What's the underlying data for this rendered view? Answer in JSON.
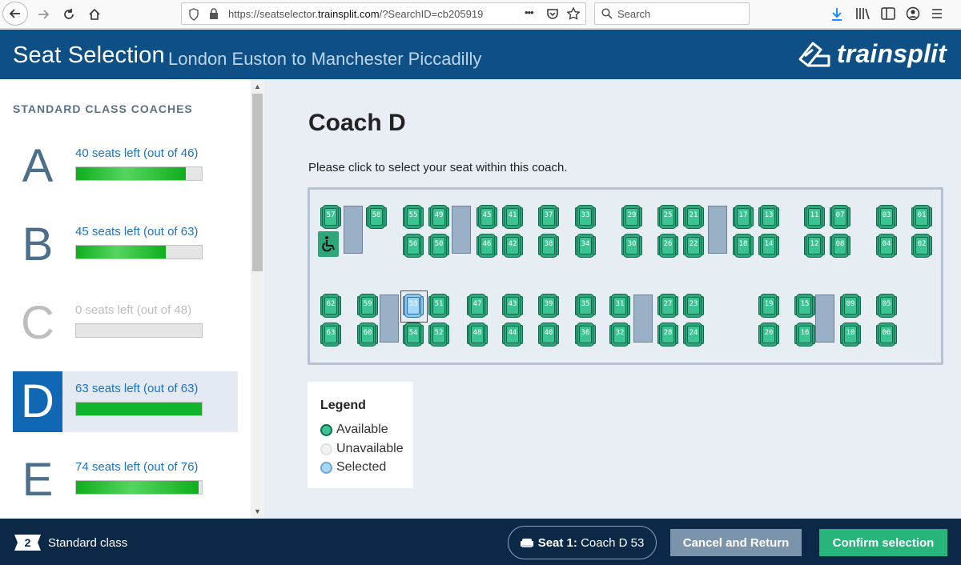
{
  "browser": {
    "url_prefix": "https://seatselector.",
    "url_domain": "trainsplit.com",
    "url_suffix": "/?SearchID=cb205919",
    "menu_dots": "•••",
    "search_placeholder": "Search"
  },
  "header": {
    "title": "Seat Selection",
    "route": "London Euston to Manchester Piccadilly",
    "brand": "trainsplit"
  },
  "sidebar": {
    "heading": "STANDARD CLASS COACHES",
    "coaches": [
      {
        "letter": "A",
        "text": "40 seats left (out of 46)",
        "fraction": 0.87,
        "state": "normal"
      },
      {
        "letter": "B",
        "text": "45 seats left (out of 63)",
        "fraction": 0.714,
        "state": "normal"
      },
      {
        "letter": "C",
        "text": "0 seats left (out of 48)",
        "fraction": 0,
        "state": "disabled"
      },
      {
        "letter": "D",
        "text": "63 seats left (out of 63)",
        "fraction": 1.0,
        "state": "active"
      },
      {
        "letter": "E",
        "text": "74 seats left (out of 76)",
        "fraction": 0.974,
        "state": "normal"
      }
    ]
  },
  "main": {
    "coach_title": "Coach D",
    "instruction": "Please click to select your seat within this coach.",
    "seats": [
      {
        "n": "57",
        "status": "available"
      },
      {
        "n": "58",
        "status": "available"
      },
      {
        "n": "55",
        "status": "available"
      },
      {
        "n": "49",
        "status": "available"
      },
      {
        "n": "56",
        "status": "available"
      },
      {
        "n": "50",
        "status": "available"
      },
      {
        "n": "45",
        "status": "available"
      },
      {
        "n": "41",
        "status": "available"
      },
      {
        "n": "46",
        "status": "available"
      },
      {
        "n": "42",
        "status": "available"
      },
      {
        "n": "37",
        "status": "available"
      },
      {
        "n": "38",
        "status": "available"
      },
      {
        "n": "33",
        "status": "available"
      },
      {
        "n": "34",
        "status": "available"
      },
      {
        "n": "29",
        "status": "available"
      },
      {
        "n": "30",
        "status": "available"
      },
      {
        "n": "25",
        "status": "available"
      },
      {
        "n": "21",
        "status": "available"
      },
      {
        "n": "26",
        "status": "available"
      },
      {
        "n": "22",
        "status": "available"
      },
      {
        "n": "17",
        "status": "available"
      },
      {
        "n": "13",
        "status": "available"
      },
      {
        "n": "18",
        "status": "available"
      },
      {
        "n": "14",
        "status": "available"
      },
      {
        "n": "11",
        "status": "available"
      },
      {
        "n": "07",
        "status": "available"
      },
      {
        "n": "12",
        "status": "available"
      },
      {
        "n": "08",
        "status": "available"
      },
      {
        "n": "03",
        "status": "available"
      },
      {
        "n": "01",
        "status": "available"
      },
      {
        "n": "04",
        "status": "available"
      },
      {
        "n": "02",
        "status": "available"
      },
      {
        "n": "62",
        "status": "available"
      },
      {
        "n": "63",
        "status": "available"
      },
      {
        "n": "59",
        "status": "available"
      },
      {
        "n": "60",
        "status": "available"
      },
      {
        "n": "53",
        "status": "selected"
      },
      {
        "n": "51",
        "status": "available"
      },
      {
        "n": "54",
        "status": "available"
      },
      {
        "n": "52",
        "status": "available"
      },
      {
        "n": "47",
        "status": "available"
      },
      {
        "n": "48",
        "status": "available"
      },
      {
        "n": "43",
        "status": "available"
      },
      {
        "n": "44",
        "status": "available"
      },
      {
        "n": "39",
        "status": "available"
      },
      {
        "n": "40",
        "status": "available"
      },
      {
        "n": "35",
        "status": "available"
      },
      {
        "n": "36",
        "status": "available"
      },
      {
        "n": "31",
        "status": "available"
      },
      {
        "n": "32",
        "status": "available"
      },
      {
        "n": "27",
        "status": "available"
      },
      {
        "n": "23",
        "status": "available"
      },
      {
        "n": "28",
        "status": "available"
      },
      {
        "n": "24",
        "status": "available"
      },
      {
        "n": "19",
        "status": "available"
      },
      {
        "n": "20",
        "status": "available"
      },
      {
        "n": "15",
        "status": "available"
      },
      {
        "n": "16",
        "status": "available"
      },
      {
        "n": "09",
        "status": "available"
      },
      {
        "n": "10",
        "status": "available"
      },
      {
        "n": "05",
        "status": "available"
      },
      {
        "n": "06",
        "status": "available"
      }
    ],
    "legend": {
      "title": "Legend",
      "items": [
        {
          "label": "Available",
          "fill": "#3cc394",
          "border": "#0e6a4a"
        },
        {
          "label": "Unavailable",
          "fill": "#f2f2f2",
          "border": "#e0e0e0"
        },
        {
          "label": "Selected",
          "fill": "#a6d6f8",
          "border": "#6aa7d6"
        }
      ]
    }
  },
  "footer": {
    "class_number": "2",
    "class_label": "Standard class",
    "seat_prefix": "Seat 1:",
    "seat_value": "Coach D 53",
    "cancel_label": "Cancel and Return",
    "confirm_label": "Confirm selection"
  },
  "colors": {
    "header_bg": "#0e4f85",
    "footer_bg": "#0b2846",
    "available": "#3cc394",
    "selected": "#a6d6f8",
    "confirm": "#27b57c",
    "cancel": "#7b93ab"
  }
}
